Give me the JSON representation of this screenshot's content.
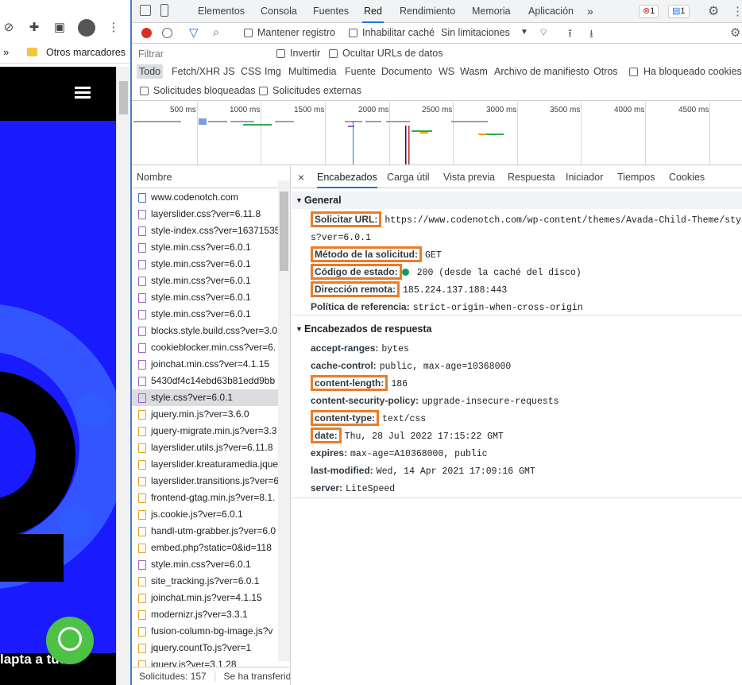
{
  "browser": {
    "bookmarks_label": "Otros marcadores",
    "site_text": "lapta a tus"
  },
  "devtools": {
    "tabs": [
      {
        "label": "Elementos"
      },
      {
        "label": "Consola"
      },
      {
        "label": "Fuentes"
      },
      {
        "label": "Red"
      },
      {
        "label": "Rendimiento"
      },
      {
        "label": "Memoria"
      },
      {
        "label": "Aplicación"
      }
    ],
    "more_tabs": "»",
    "error_count": "1",
    "message_count": "1",
    "toolbar": {
      "preserve_log": "Mantener registro",
      "disable_cache": "Inhabilitar caché",
      "throttling": "Sin limitaciones"
    },
    "filter": {
      "placeholder": "Filtrar",
      "invert": "Invertir",
      "hide_data_urls": "Ocultar URLs de datos"
    },
    "types": [
      "Todo",
      "Fetch/XHR",
      "JS",
      "CSS",
      "Img",
      "Multimedia",
      "Fuente",
      "Documento",
      "WS",
      "Wasm",
      "Archivo de manifiesto",
      "Otros"
    ],
    "blocked_cookies": "Ha bloqueado cookies",
    "blocked_requests": "Solicitudes bloqueadas",
    "third_party": "Solicitudes externas",
    "timeline_ticks": [
      "500 ms",
      "1000 ms",
      "1500 ms",
      "2000 ms",
      "2500 ms",
      "3000 ms",
      "3500 ms",
      "4000 ms",
      "4500 ms"
    ]
  },
  "requests": {
    "header": "Nombre",
    "items": [
      {
        "name": "www.codenotch.com",
        "type": "doc"
      },
      {
        "name": "layerslider.css?ver=6.11.8",
        "type": "css"
      },
      {
        "name": "style-index.css?ver=16371535",
        "type": "css"
      },
      {
        "name": "style.min.css?ver=6.0.1",
        "type": "css"
      },
      {
        "name": "style.min.css?ver=6.0.1",
        "type": "css"
      },
      {
        "name": "style.min.css?ver=6.0.1",
        "type": "css"
      },
      {
        "name": "style.min.css?ver=6.0.1",
        "type": "css"
      },
      {
        "name": "style.min.css?ver=6.0.1",
        "type": "css"
      },
      {
        "name": "blocks.style.build.css?ver=3.0.",
        "type": "css"
      },
      {
        "name": "cookieblocker.min.css?ver=6.",
        "type": "css"
      },
      {
        "name": "joinchat.min.css?ver=4.1.15",
        "type": "css"
      },
      {
        "name": "5430df4c14ebd63b81edd9bb",
        "type": "css"
      },
      {
        "name": "style.css?ver=6.0.1",
        "type": "css",
        "selected": true
      },
      {
        "name": "jquery.min.js?ver=3.6.0",
        "type": "js"
      },
      {
        "name": "jquery-migrate.min.js?ver=3.3",
        "type": "js"
      },
      {
        "name": "layerslider.utils.js?ver=6.11.8",
        "type": "js"
      },
      {
        "name": "layerslider.kreaturamedia.jque",
        "type": "js"
      },
      {
        "name": "layerslider.transitions.js?ver=6",
        "type": "js"
      },
      {
        "name": "frontend-gtag.min.js?ver=8.1.",
        "type": "js"
      },
      {
        "name": "js.cookie.js?ver=6.0.1",
        "type": "js"
      },
      {
        "name": "handl-utm-grabber.js?ver=6.0",
        "type": "js"
      },
      {
        "name": "embed.php?static=0&id=118",
        "type": "js"
      },
      {
        "name": "style.min.css?ver=6.0.1",
        "type": "css"
      },
      {
        "name": "site_tracking.js?ver=6.0.1",
        "type": "js"
      },
      {
        "name": "joinchat.min.js?ver=4.1.15",
        "type": "js"
      },
      {
        "name": "modernizr.js?ver=3.3.1",
        "type": "js"
      },
      {
        "name": "fusion-column-bg-image.js?v",
        "type": "js"
      },
      {
        "name": "jquery.countTo.js?ver=1",
        "type": "js"
      },
      {
        "name": "jquery.js?ver=3.1.28",
        "type": "js"
      }
    ],
    "status_count": "Solicitudes: 157",
    "status_transfer": "Se ha transferid"
  },
  "detail": {
    "tabs": [
      "Encabezados",
      "Carga útil",
      "Vista previa",
      "Respuesta",
      "Iniciador",
      "Tiempos",
      "Cookies"
    ],
    "general_title": "General",
    "general": [
      {
        "name": "Solicitar URL:",
        "value": "https://www.codenotch.com/wp-content/themes/Avada-Child-Theme/style.cs",
        "boxed": true
      },
      {
        "name": "",
        "value": "s?ver=6.0.1",
        "boxed": false
      },
      {
        "name": "Método de la solicitud:",
        "value": "GET",
        "boxed": true
      },
      {
        "name": "Código de estado:",
        "value": "200  (desde la caché del disco)",
        "boxed": true,
        "dot": true
      },
      {
        "name": "Dirección remota:",
        "value": "185.224.137.188:443",
        "boxed": true
      },
      {
        "name": "Política de referencia:",
        "value": "strict-origin-when-cross-origin",
        "boxed": false
      }
    ],
    "response_title": "Encabezados de respuesta",
    "response": [
      {
        "name": "accept-ranges:",
        "value": "bytes",
        "boxed": false
      },
      {
        "name": "cache-control:",
        "value": "public, max-age=10368000",
        "boxed": false
      },
      {
        "name": "content-length:",
        "value": "186",
        "boxed": true
      },
      {
        "name": "content-security-policy:",
        "value": "upgrade-insecure-requests",
        "boxed": false
      },
      {
        "name": "content-type:",
        "value": "text/css",
        "boxed": true
      },
      {
        "name": "date:",
        "value": "Thu, 28 Jul 2022 17:15:22 GMT",
        "boxed": true
      },
      {
        "name": "expires:",
        "value": "max-age=A10368000, public",
        "boxed": false
      },
      {
        "name": "last-modified:",
        "value": "Wed, 14 Apr 2021 17:09:16 GMT",
        "boxed": false
      },
      {
        "name": "server:",
        "value": "LiteSpeed",
        "boxed": false
      }
    ]
  },
  "colors": {
    "accent": "#1a73e8",
    "highlight": "#ee7b24",
    "status_ok": "#0f9d58",
    "hero": "#1a1aff",
    "record": "#d93025"
  }
}
